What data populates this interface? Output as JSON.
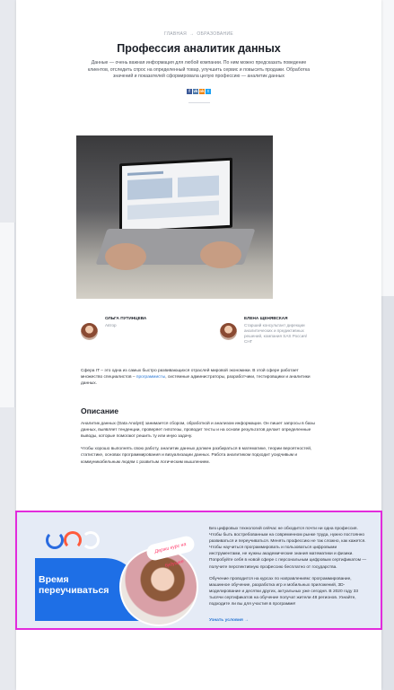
{
  "breadcrumb": {
    "home": "ГЛАВНАЯ",
    "separator": "→",
    "section": "ОБРАЗОВАНИЕ"
  },
  "article": {
    "title": "Профессия аналитик данных",
    "lead": "Данные — очень важная информация для любой компании. По ним можно предсказать поведение клиентов, отследить спрос на определенный товар, улучшить сервис и повысить продажи. Обработка значений и показателей сформировала целую профессию — аналитик данных"
  },
  "share": {
    "icons": [
      "facebook-icon",
      "vk-icon",
      "odnoklassniki-icon",
      "twitter-icon"
    ],
    "glyphs": [
      "f",
      "vk",
      "ok",
      "t"
    ],
    "colors": [
      "#3b5998",
      "#4a76a8",
      "#ee8208",
      "#1da1f2"
    ]
  },
  "authors": [
    {
      "name": "ОЛЬГА ПУТИНЦЕВА",
      "role": "Автор"
    },
    {
      "name": "ЕЛЕНА ЩЕНЯВСКАЯ",
      "role": "Старший консультант дирекции аналитических и предиктивных решений, компания SAS Россия/СНГ"
    }
  ],
  "body": {
    "intro_before_link": "Сфера IT – это одна из самых быстро развивающихся отраслей мировой экономики. В этой сфере работает множество специалистов – ",
    "intro_link": "программисты",
    "intro_after_link": ", системные администраторы, разработчики, тестировщики и аналитики данных.",
    "section_heading": "Описание",
    "paragraph_2": "Аналитик данных (Data Analyst) занимается сбором, обработкой и анализом информации. Он пишет запросы в базы данных, выявляет тенденции, проверяет гипотезы, проводит тесты и на основе результатов делает определенные выводы, которые помогают решить ту или иную задачу.",
    "paragraph_3": "Чтобы хорошо выполнять свою работу, аналитик данных должен разбираться в математике, теории вероятностей, статистике, основах программирования и визуализации данных. Работа аналитиком подходит усидчивым и коммуникабельным людям с развитым логическим мышлением."
  },
  "promo": {
    "banner_title": "Время переучиваться",
    "badge": "Держи курс на будущее",
    "paragraph_1": "Без цифровых технологий сейчас не обходится почти ни одна профессия. Чтобы быть востребованным на современном рынке труда, нужно постоянно развиваться и переучиваться. Менять профессию не так сложно, как кажется. Чтобы научиться программировать и пользоваться цифровыми инструментами, не нужны академические знания математики и физики. Попробуйте себя в новой сфере с персональным цифровым сертификатом — получите перспективную профессию бесплатно от государства.",
    "paragraph_2": "Обучение проводится на курсах по направлениям: программирование, машинное обучение, разработка игр и мобильных приложений, 3D-моделирование и десятки других, актуальных уже сегодня. В 2020 году 33 тысячи сертификатов на обучение получат жители 48 регионов. Узнайте, подходите ли вы для участия в программе!",
    "cta": "Узнать условия →",
    "accent_color": "#1e6fe6",
    "highlight_color": "#e22bdc"
  }
}
